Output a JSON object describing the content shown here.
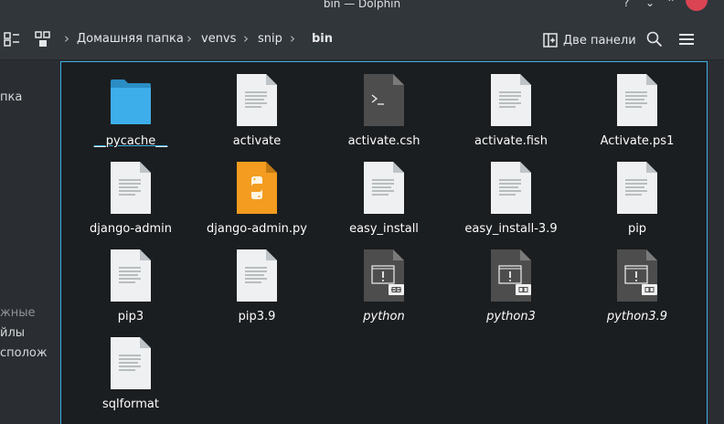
{
  "window": {
    "title": "bin — Dolphin",
    "help_glyph": "?",
    "minimize_glyph": "⌄",
    "maximize_glyph": "⌃"
  },
  "toolbar": {
    "breadcrumbs": [
      {
        "label": "Домашняя папка"
      },
      {
        "label": "venvs"
      },
      {
        "label": "snip"
      },
      {
        "label": "bin"
      }
    ],
    "split_label": "Две панели"
  },
  "places": {
    "cut_items": [
      "пка",
      "жные",
      "йлы",
      "сполож"
    ]
  },
  "files": [
    {
      "name": "__pycache__",
      "icon": "folder-icon"
    },
    {
      "name": "activate",
      "icon": "text-file-icon"
    },
    {
      "name": "activate.csh",
      "icon": "script-file-icon"
    },
    {
      "name": "activate.fish",
      "icon": "text-file-icon"
    },
    {
      "name": "Activate.ps1",
      "icon": "text-file-icon"
    },
    {
      "name": "django-admin",
      "icon": "text-file-icon"
    },
    {
      "name": "django-admin.py",
      "icon": "python-file-icon"
    },
    {
      "name": "easy_install",
      "icon": "text-file-icon"
    },
    {
      "name": "easy_install-3.9",
      "icon": "text-file-icon"
    },
    {
      "name": "pip",
      "icon": "text-file-icon"
    },
    {
      "name": "pip3",
      "icon": "text-file-icon"
    },
    {
      "name": "pip3.9",
      "icon": "text-file-icon"
    },
    {
      "name": "python",
      "icon": "executable-link-icon"
    },
    {
      "name": "python3",
      "icon": "executable-link-icon"
    },
    {
      "name": "python3.9",
      "icon": "executable-link-icon"
    },
    {
      "name": "sqlformat",
      "icon": "text-file-icon"
    }
  ],
  "colors": {
    "accent": "#3daee9",
    "close": "#da4453",
    "folder": "#3daee9",
    "python": "#f39c1f"
  }
}
